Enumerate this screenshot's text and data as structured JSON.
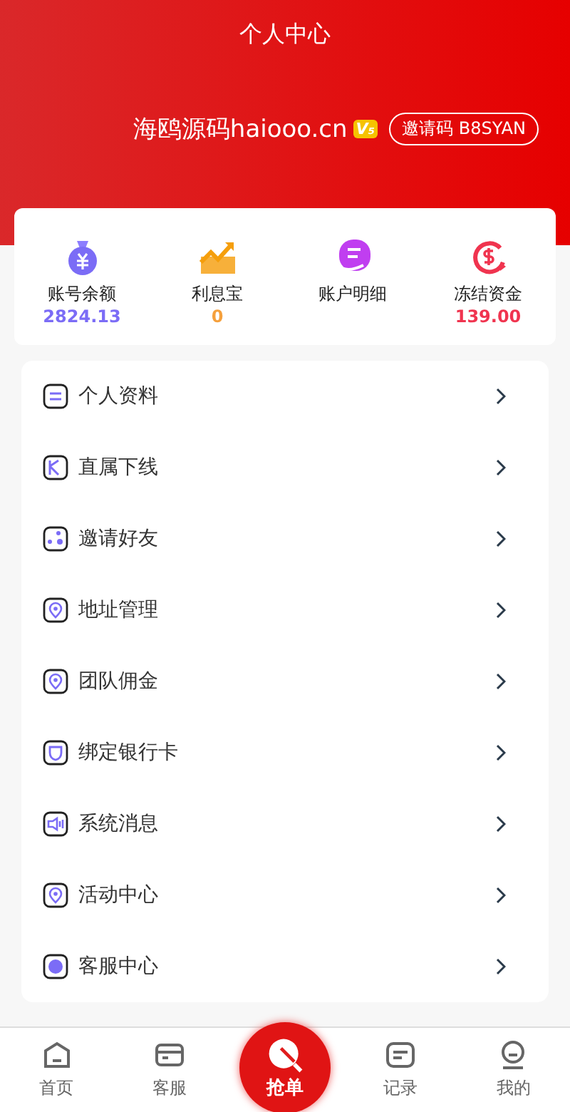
{
  "header": {
    "title": "个人中心",
    "username": "海鸥源码haiooo.cn",
    "vip_badge": "V₅",
    "invite_code": "邀请码 B8SYAN"
  },
  "stats": [
    {
      "label": "账号余额",
      "value": "2824.13",
      "color": "#7b6cf6"
    },
    {
      "label": "利息宝",
      "value": "0",
      "color": "#f5a03c"
    },
    {
      "label": "账户明细"
    },
    {
      "label": "冻结资金",
      "value": "139.00",
      "color": "#f0344f"
    }
  ],
  "menu": [
    {
      "label": "个人资料"
    },
    {
      "label": "直属下线"
    },
    {
      "label": "邀请好友"
    },
    {
      "label": "地址管理"
    },
    {
      "label": "团队佣金"
    },
    {
      "label": "绑定银行卡"
    },
    {
      "label": "系统消息"
    },
    {
      "label": "活动中心"
    },
    {
      "label": "客服中心"
    }
  ],
  "nav": [
    {
      "label": "首页",
      "kind": "tab"
    },
    {
      "label": "客服",
      "kind": "tab"
    },
    {
      "label": "抢单",
      "kind": "center"
    },
    {
      "label": "记录",
      "kind": "tab"
    },
    {
      "label": "我的",
      "kind": "tab"
    }
  ]
}
